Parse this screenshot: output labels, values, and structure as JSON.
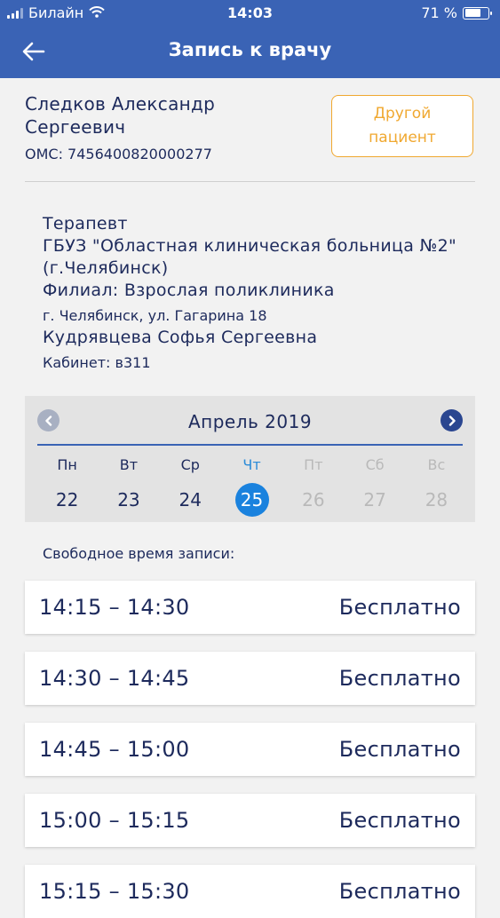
{
  "status_bar": {
    "carrier": "Билайн",
    "time": "14:03",
    "battery": "71 %",
    "battery_level": 0.71
  },
  "nav": {
    "title": "Запись к врачу",
    "back_icon": "arrow-left-icon"
  },
  "patient": {
    "name": "Следков Александр Сергеевич",
    "oms": "ОМС: 7456400820000277",
    "other_button": "Другой пациент"
  },
  "doctor": {
    "specialty": "Терапевт",
    "hospital": "ГБУЗ \"Областная клиническая больница №2\" (г.Челябинск)",
    "branch": "Филиал: Взрослая поликлиника",
    "address": "г. Челябинск, ул. Гагарина 18",
    "name": "Кудрявцева Софья Сергеевна",
    "cabinet": "Кабинет: в311"
  },
  "calendar": {
    "month": "Апрель 2019",
    "days": [
      {
        "dow": "Пн",
        "num": "22",
        "state": "active"
      },
      {
        "dow": "Вт",
        "num": "23",
        "state": "active"
      },
      {
        "dow": "Ср",
        "num": "24",
        "state": "active"
      },
      {
        "dow": "Чт",
        "num": "25",
        "state": "selected"
      },
      {
        "dow": "Пт",
        "num": "26",
        "state": "disabled"
      },
      {
        "dow": "Сб",
        "num": "27",
        "state": "disabled"
      },
      {
        "dow": "Вс",
        "num": "28",
        "state": "disabled"
      }
    ]
  },
  "slots_label": "Свободное время записи:",
  "slots": [
    {
      "time": "14:15 – 14:30",
      "price": "Бесплатно"
    },
    {
      "time": "14:30 – 14:45",
      "price": "Бесплатно"
    },
    {
      "time": "14:45 – 15:00",
      "price": "Бесплатно"
    },
    {
      "time": "15:00 – 15:15",
      "price": "Бесплатно"
    },
    {
      "time": "15:15 – 15:30",
      "price": "Бесплатно"
    }
  ],
  "colors": {
    "header": "#3a63b5",
    "accent_orange": "#f0a830",
    "selected_day": "#1a82de",
    "text_dark": "#1d2a5c"
  }
}
